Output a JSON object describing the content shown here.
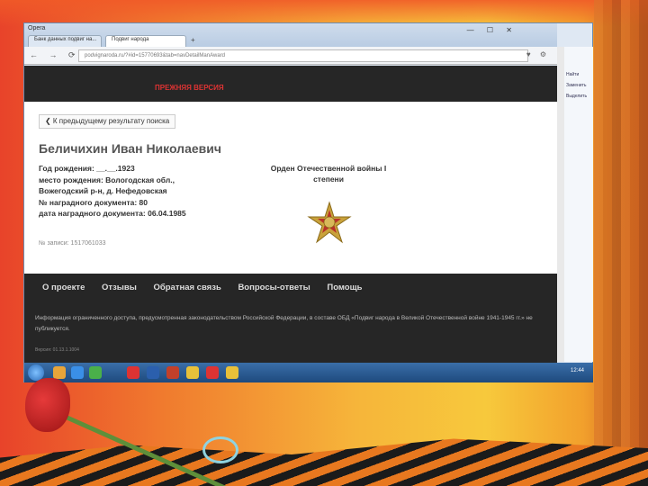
{
  "browser": {
    "app_badge": "Opera",
    "tabs": [
      {
        "label": "Банк данных подвиг на..."
      },
      {
        "label": "Подвиг народа"
      }
    ],
    "new_tab": "+",
    "window_controls": "— ☐ ✕",
    "url": "podvignaroda.ru/?#id=15770693&tab=navDetailManAward",
    "nav_icons": "← → ⟳ ⌂",
    "url_icons": "♥ ⚙"
  },
  "site": {
    "old_version": "ПРЕЖНЯЯ ВЕРСИЯ",
    "back_button": "❮ К предыдущему результату поиска",
    "person_name": "Беличихин Иван Николаевич",
    "details": [
      "Год рождения: __.__.1923",
      "место рождения: Вологодская обл.,",
      "Вожегодский р-н, д. Нефедовская",
      "№ наградного документа: 80",
      "дата наградного документа: 06.04.1985"
    ],
    "record": "№ записи: 1517061033",
    "award_title_1": "Орден Отечественной войны I",
    "award_title_2": "степени",
    "footer_links": [
      "О проекте",
      "Отзывы",
      "Обратная связь",
      "Вопросы-ответы",
      "Помощь"
    ],
    "footer_note": "Информация ограниченного доступа, предусмотренная законодательством Российской Федерации, в составе ОБД «Подвиг народа в Великой Отечественной войне 1941-1945 гг.» не публикуется.",
    "footer_tiny": "Версия: 01.13.1.1004"
  },
  "side_panel": {
    "items": [
      "Найти",
      "Заменить",
      "Выделить"
    ]
  },
  "taskbar": {
    "clock": "12:44"
  },
  "colors": {
    "site_dark": "#262626",
    "old_version_red": "#dd3333"
  }
}
